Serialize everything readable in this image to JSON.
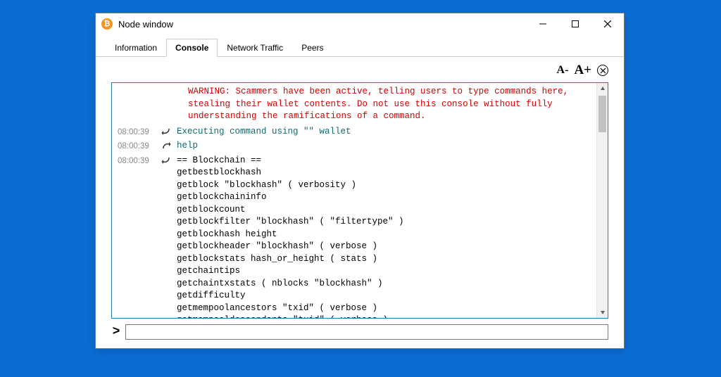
{
  "window": {
    "title": "Node window"
  },
  "tabs": [
    "Information",
    "Console",
    "Network Traffic",
    "Peers"
  ],
  "active_tab": 1,
  "toolbar": {
    "font_smaller": "A-",
    "font_larger": "A+",
    "clear": "✕"
  },
  "console": {
    "warning": "WARNING: Scammers have been active, telling users to type commands here, stealing their wallet contents. Do not use this console without fully understanding the ramifications of a command.",
    "entries": [
      {
        "ts": "08:00:39",
        "dir": "in",
        "text": "Executing command using \"\" wallet",
        "cls": "teal"
      },
      {
        "ts": "08:00:39",
        "dir": "out",
        "text": "help",
        "cls": "teal"
      },
      {
        "ts": "08:00:39",
        "dir": "in",
        "text": "== Blockchain ==\ngetbestblockhash\ngetblock \"blockhash\" ( verbosity )\ngetblockchaininfo\ngetblockcount\ngetblockfilter \"blockhash\" ( \"filtertype\" )\ngetblockhash height\ngetblockheader \"blockhash\" ( verbose )\ngetblockstats hash_or_height ( stats )\ngetchaintips\ngetchaintxstats ( nblocks \"blockhash\" )\ngetdifficulty\ngetmempoolancestors \"txid\" ( verbose )\ngetmempooldescendants \"txid\" ( verbose )\ngetmempoolentry \"txid\"\ngetmempoolinfo",
        "cls": ""
      }
    ]
  },
  "input": {
    "prompt": ">",
    "value": ""
  }
}
